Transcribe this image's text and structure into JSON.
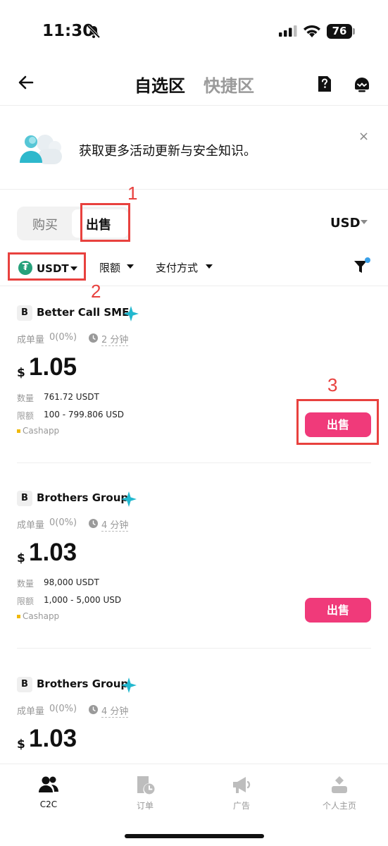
{
  "status_bar": {
    "time": "11:30",
    "battery": "76"
  },
  "header": {
    "tab_active": "自选区",
    "tab_other": "快捷区"
  },
  "banner": {
    "text": "获取更多活动更新与安全知识。",
    "close_symbol": "×"
  },
  "trade_toggle": {
    "buy": "购买",
    "sell": "出售",
    "selected": "出售"
  },
  "currency": "USD",
  "filters": {
    "coin": "USDT",
    "coin_symbol": "₮",
    "limit": "限额",
    "payment": "支付方式"
  },
  "annotations": {
    "mark1": "1",
    "mark2": "2",
    "mark3": "3"
  },
  "listings": [
    {
      "initial": "B",
      "name": "Better Call SME",
      "stats_label": "成单量",
      "stats_value": "0(0%)",
      "time": "2 分钟",
      "currency_symbol": "$",
      "price": "1.05",
      "qty_label": "数量",
      "qty_value": "761.72 USDT",
      "limit_label": "限额",
      "limit_value": "100 - 799.806 USD",
      "payment": "Cashapp",
      "action": "出售"
    },
    {
      "initial": "B",
      "name": "Brothers Group",
      "stats_label": "成单量",
      "stats_value": "0(0%)",
      "time": "4 分钟",
      "currency_symbol": "$",
      "price": "1.03",
      "qty_label": "数量",
      "qty_value": "98,000 USDT",
      "limit_label": "限额",
      "limit_value": "1,000 - 5,000 USD",
      "payment": "Cashapp",
      "action": "出售"
    },
    {
      "initial": "B",
      "name": "Brothers Group",
      "stats_label": "成单量",
      "stats_value": "0(0%)",
      "time": "4 分钟",
      "currency_symbol": "$",
      "price": "1.03"
    }
  ],
  "bottom_nav": [
    {
      "label": "C2C",
      "icon": "users-icon",
      "active": true
    },
    {
      "label": "订单",
      "icon": "orders-icon",
      "active": false
    },
    {
      "label": "广告",
      "icon": "megaphone-icon",
      "active": false
    },
    {
      "label": "个人主页",
      "icon": "profile-icon",
      "active": false
    }
  ],
  "colors": {
    "accent_pink": "#f03a7a",
    "annotation_red": "#e8413e",
    "tether_green": "#26a17b",
    "payment_dot": "#f0b90b"
  }
}
